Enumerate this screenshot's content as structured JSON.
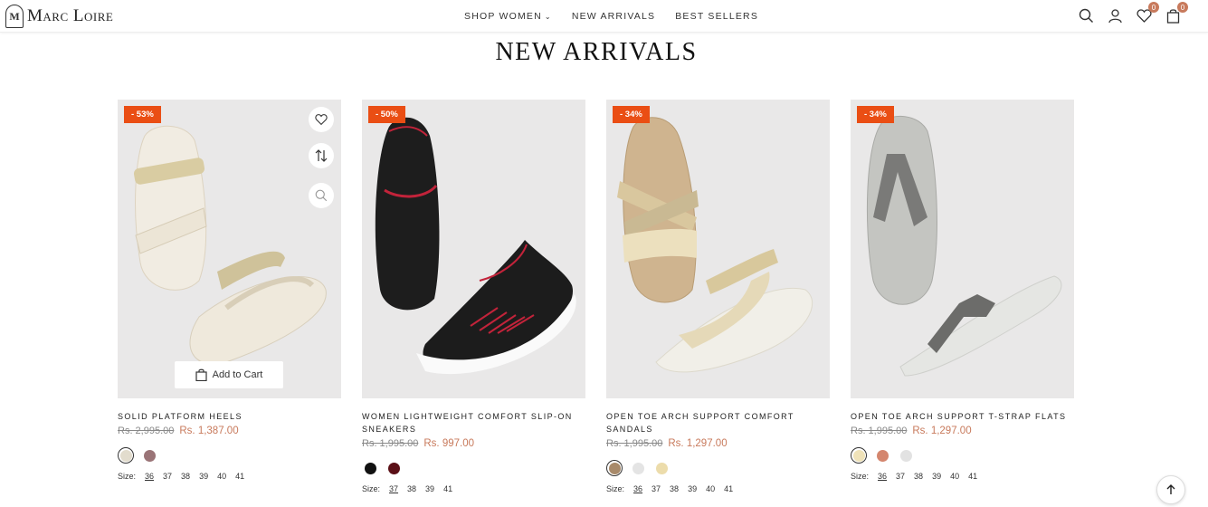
{
  "brand": {
    "name": "Marc Loire",
    "mark": "M"
  },
  "nav": [
    {
      "label": "SHOP WOMEN",
      "dropdown": true
    },
    {
      "label": "NEW ARRIVALS"
    },
    {
      "label": "BEST SELLERS"
    }
  ],
  "header_icons": {
    "wishlist_count": "0",
    "cart_count": "0"
  },
  "section_title": "NEW ARRIVALS",
  "add_to_cart_label": "Add to Cart",
  "size_label": "Size:",
  "colors": {
    "accent": "#c87a5c",
    "discount_bg": "#ea4e14"
  },
  "products": [
    {
      "discount": "- 53%",
      "name": "SOLID PLATFORM HEELS",
      "old_price": "Rs. 2,995.00",
      "price": "Rs. 1,387.00",
      "swatches": [
        "#e2dccd",
        "#9a7477"
      ],
      "selected_swatch": 0,
      "sizes": [
        "36",
        "37",
        "38",
        "39",
        "40",
        "41"
      ],
      "selected_size": 0
    },
    {
      "discount": "- 50%",
      "name": "WOMEN LIGHTWEIGHT COMFORT SLIP-ON SNEAKERS",
      "old_price": "Rs. 1,995.00",
      "price": "Rs. 997.00",
      "swatches": [
        "#111111",
        "#5a0f16"
      ],
      "selected_swatch": -1,
      "sizes": [
        "37",
        "38",
        "39",
        "41"
      ],
      "selected_size": 0
    },
    {
      "discount": "- 34%",
      "name": "OPEN TOE ARCH SUPPORT COMFORT SANDALS",
      "old_price": "Rs. 1,995.00",
      "price": "Rs. 1,297.00",
      "swatches": [
        "#a88a6a",
        "#e4e4e4",
        "#ecdcab"
      ],
      "selected_swatch": 0,
      "sizes": [
        "36",
        "37",
        "38",
        "39",
        "40",
        "41"
      ],
      "selected_size": 0
    },
    {
      "discount": "- 34%",
      "name": "OPEN TOE ARCH SUPPORT T-STRAP FLATS",
      "old_price": "Rs. 1,995.00",
      "price": "Rs. 1,297.00",
      "swatches": [
        "#efe2b8",
        "#d4866e",
        "#e2e2e2"
      ],
      "selected_swatch": 0,
      "sizes": [
        "36",
        "37",
        "38",
        "39",
        "40",
        "41"
      ],
      "selected_size": 0
    }
  ]
}
